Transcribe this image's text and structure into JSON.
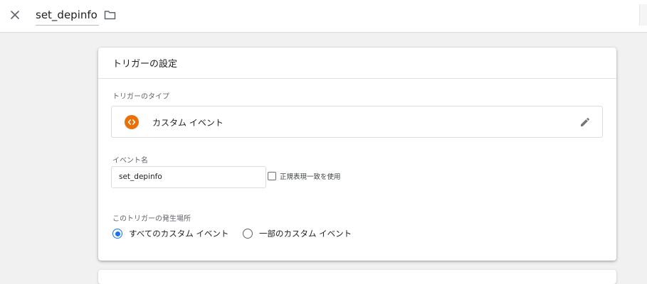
{
  "topbar": {
    "title": "set_depinfo",
    "close_icon": "close-icon",
    "folder_icon": "folder-icon"
  },
  "card": {
    "header": "トリガーの設定",
    "trigger_type": {
      "label": "トリガーのタイプ",
      "value": "カスタム イベント",
      "icon": "custom-event-icon",
      "icon_color": "#e8710a",
      "edit_icon": "pencil-icon"
    },
    "event_name": {
      "label": "イベント名",
      "value": "set_depinfo",
      "regex_label": "正規表現一致を使用",
      "regex_checked": false
    },
    "fires_on": {
      "label": "このトリガーの発生場所",
      "options": [
        {
          "label": "すべてのカスタム イベント",
          "selected": true
        },
        {
          "label": "一部のカスタム イベント",
          "selected": false
        }
      ]
    }
  },
  "colors": {
    "accent": "#1a73e8",
    "background": "#f1f1f1"
  }
}
